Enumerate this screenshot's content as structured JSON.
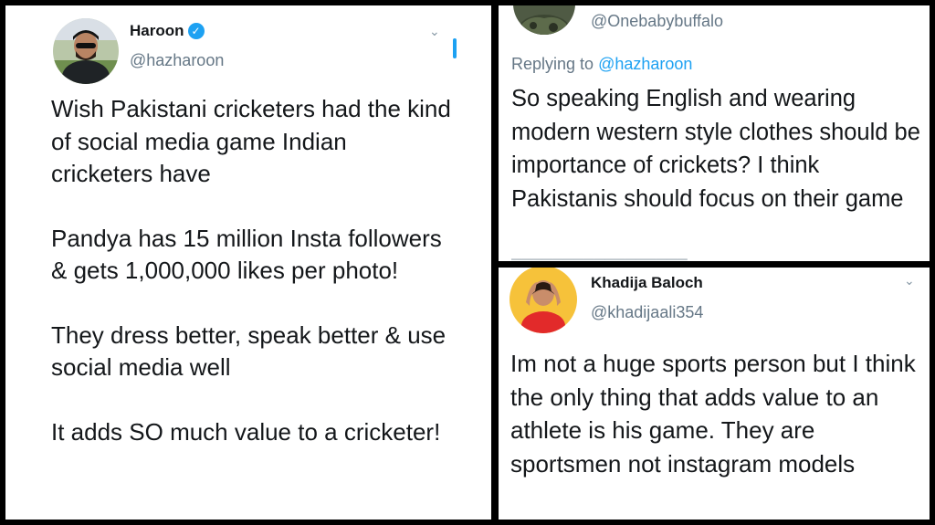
{
  "tweet1": {
    "name": "Haroon",
    "verified_icon": "verified-badge-icon",
    "handle": "@hazharoon",
    "paragraphs": [
      "Wish Pakistani cricketers had the kind of social media game Indian cricketers have",
      "Pandya has 15 million Insta followers & gets 1,000,000 likes per photo!",
      "They dress better, speak better & use social media well",
      "It adds SO much value to a cricketer!"
    ]
  },
  "tweet2": {
    "handle": "@Onebabybuffalo",
    "replying_prefix": "Replying to ",
    "replying_handle": "@hazharoon",
    "text": "So speaking English and wearing modern western style clothes should be importance of crickets? I think Pakistanis should focus on their game"
  },
  "tweet3": {
    "name": "Khadija Baloch",
    "handle": "@khadijaali354",
    "text": "Im not a huge sports person but I think the only thing that adds value to an athlete is his game. They are sportsmen not instagram models"
  },
  "colors": {
    "link": "#1da1f2",
    "secondary_text": "#657786",
    "primary_text": "#14171a"
  }
}
